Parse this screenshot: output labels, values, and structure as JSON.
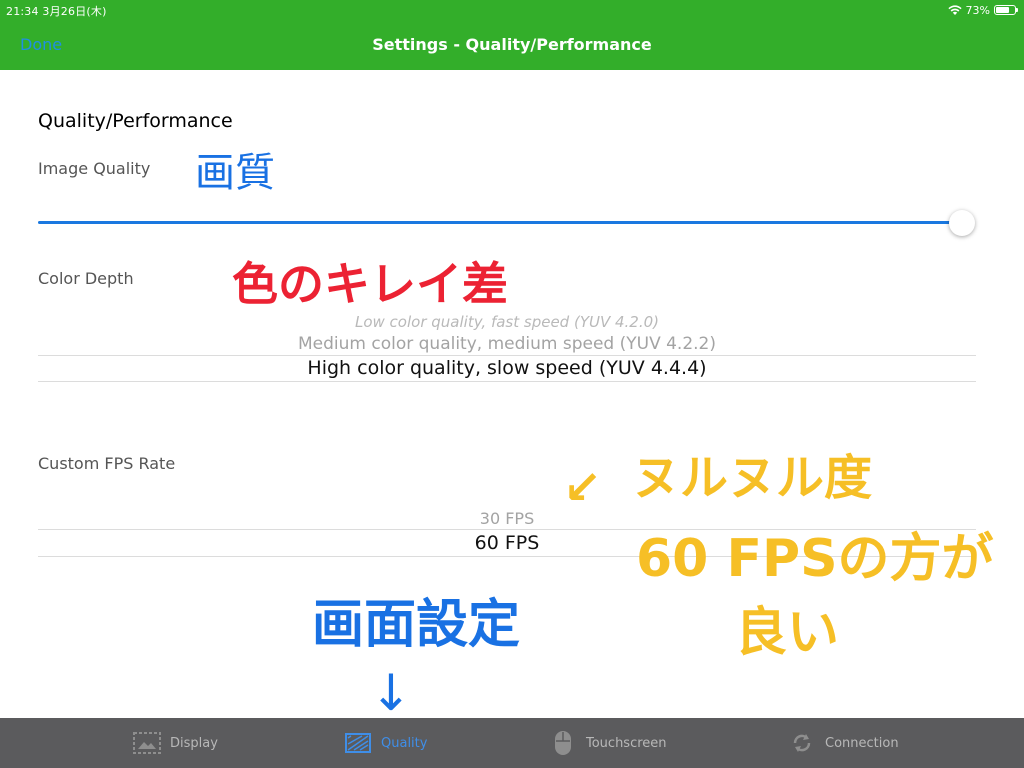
{
  "status_bar": {
    "time_date": "21:34   3月26日(木)",
    "battery": "73%",
    "battery_level": 0.73
  },
  "nav": {
    "done_label": "Done",
    "title": "Settings - Quality/Performance"
  },
  "content": {
    "section_title": "Quality/Performance",
    "image_quality": {
      "label": "Image Quality",
      "value": 1.0
    },
    "color_depth": {
      "label": "Color Depth",
      "options": [
        "Low color quality, fast speed (YUV 4.2.0)",
        "Medium color quality, medium speed (YUV 4.2.2)",
        "High color quality, slow speed (YUV 4.4.4)"
      ],
      "selected": "High color quality, slow speed (YUV 4.4.4)"
    },
    "fps": {
      "label": "Custom FPS Rate",
      "options": [
        "30 FPS",
        "60 FPS"
      ],
      "selected": "60 FPS"
    }
  },
  "annotations": {
    "image_quality_note": "画質",
    "color_depth_note": "色のキレイ差",
    "fps_note_1": "ヌルヌル度",
    "fps_note_2": "60 FPSの方が",
    "fps_note_3": "良い",
    "bottom_note": "画面設定",
    "arrow_yellow": "↙",
    "arrow_blue": "↓"
  },
  "tab_bar": {
    "tabs": [
      {
        "label": "Display",
        "icon": "display-icon"
      },
      {
        "label": "Quality",
        "icon": "quality-icon",
        "active": true
      },
      {
        "label": "Touchscreen",
        "icon": "mouse-icon"
      },
      {
        "label": "Connection",
        "icon": "connection-icon"
      }
    ]
  },
  "colors": {
    "nav_background": "#33ae2a",
    "accent_blue": "#1a78e0",
    "tab_bar_background": "#5b5b5d",
    "annotation_blue": "#1971e3",
    "annotation_red": "#ec2233",
    "annotation_yellow": "#f6bf26"
  }
}
